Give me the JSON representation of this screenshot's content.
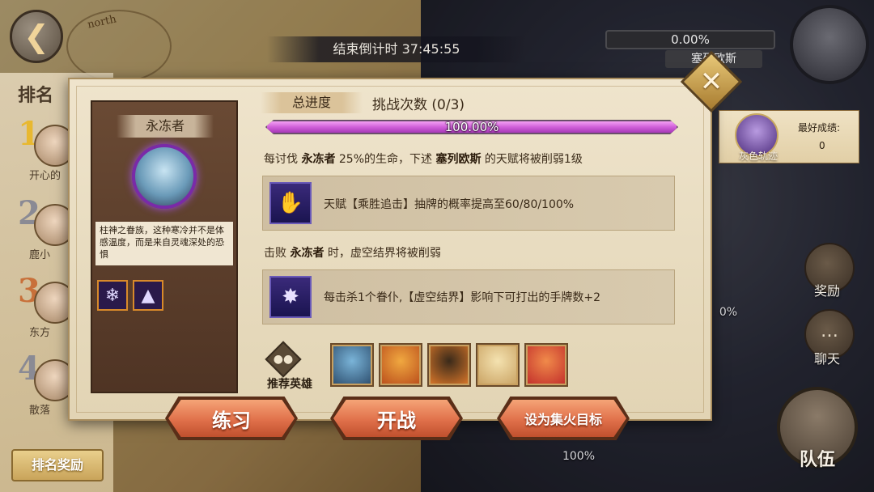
{
  "topbar": {
    "countdown": "结束倒计时 37:45:55",
    "boss_percent": "0.00%",
    "boss_name": "塞列欧斯"
  },
  "rank": {
    "title": "排名",
    "entries": [
      {
        "num": "1",
        "name": "开心的",
        "color": "#e8b830"
      },
      {
        "num": "2",
        "name": "鹿小",
        "color": "#8a8a94"
      },
      {
        "num": "3",
        "name": "东方",
        "color": "#c8703a"
      },
      {
        "num": "4",
        "name": "散落",
        "color": "#8a8a94"
      }
    ],
    "reward_button": "排名奖励"
  },
  "sidebar": {
    "reward_label": "奖励",
    "chat_label": "聊天",
    "team_label": "队伍",
    "bottom_percent": "100%",
    "mid_percent": "0%"
  },
  "best_score": {
    "avatar_name": "灰色轨迹",
    "label": "最好成绩:",
    "value": "0"
  },
  "dialog": {
    "boss": {
      "name": "永冻者",
      "description": "柱神之眷族，这种寒冷并不是体感温度，而是来自灵魂深处的恐惧",
      "skills": [
        "snowflake-icon",
        "ice-spikes-icon"
      ]
    },
    "progress_tag": "总进度",
    "challenge_count": "挑战次数 (0/3)",
    "progress_value": 100,
    "progress_text": "100.00%",
    "rule1": {
      "p1": "每讨伐 ",
      "boss": "永冻者",
      "p2": " 25%的生命，下述 ",
      "target": "塞列欧斯",
      "p3": " 的天赋将被削弱1级"
    },
    "effect1": "天赋【乘胜追击】抽牌的概率提高至60/80/100%",
    "rule2": {
      "p1": "击败 ",
      "boss": "永冻者",
      "p2": " 时，虚空结界将被削弱"
    },
    "effect2": "每击杀1个眷仆,【虚空结界】影响下可打出的手牌数+2",
    "recommended_label": "推荐英雄",
    "heroes": [
      {
        "name": "hero-1",
        "color1": "#7ab4d8",
        "color2": "#2a4a6a"
      },
      {
        "name": "hero-2",
        "color1": "#f0a840",
        "color2": "#b84a1a"
      },
      {
        "name": "hero-3",
        "color1": "#3a2a1a",
        "color2": "#e07a2a"
      },
      {
        "name": "hero-4",
        "color1": "#f4e2b0",
        "color2": "#c8a060"
      },
      {
        "name": "hero-5",
        "color1": "#f08a4a",
        "color2": "#c02a2a"
      }
    ],
    "buttons": {
      "practice": "练习",
      "battle": "开战",
      "focus": "设为集火目标"
    }
  }
}
